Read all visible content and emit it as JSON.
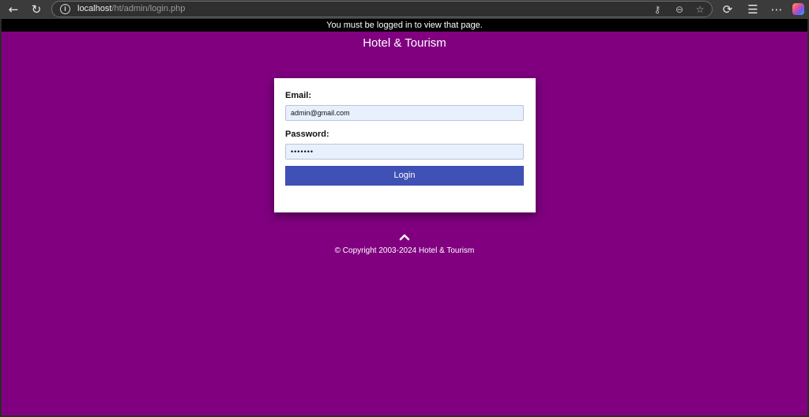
{
  "browser": {
    "url_host": "localhost",
    "url_path": "/ht/admin/login.php",
    "icons": [
      "back-icon",
      "reload-icon",
      "info-icon",
      "key-icon",
      "zoom-icon",
      "favorite-star-icon",
      "refresh-extension-icon",
      "favorites-icon",
      "more-icon",
      "copilot-icon"
    ]
  },
  "page": {
    "alert": "You must be logged in to view that page.",
    "site_title": "Hotel & Tourism",
    "form": {
      "email_label": "Email:",
      "email_value": "admin@gmail.com",
      "password_label": "Password:",
      "password_value": "•••••••",
      "login_label": "Login"
    },
    "copyright": "© Copyright 2003-2024 Hotel & Tourism"
  },
  "colors": {
    "page_background": "#800080",
    "alert_background": "#000000",
    "button": "#3f51b5",
    "input_background": "#e8f0fe"
  }
}
